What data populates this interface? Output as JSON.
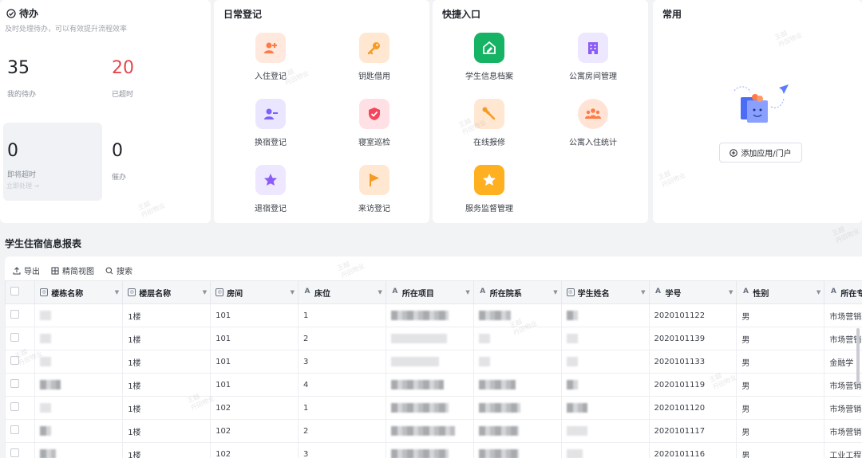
{
  "todo": {
    "title": "待办",
    "subtitle": "及时处理待办，可以有效提升流程效率",
    "my_todo": {
      "value": "35",
      "label": "我的待办"
    },
    "overdue": {
      "value": "20",
      "label": "已超时"
    },
    "soon": {
      "value": "0",
      "label": "即将超时",
      "link": "立即处理 →"
    },
    "pending": {
      "value": "0",
      "label": "催办"
    }
  },
  "daily": {
    "title": "日常登记",
    "items": [
      {
        "label": "入住登记",
        "icon": "user-add-icon",
        "color": "#ff7a45",
        "bg": "#ffe8dd"
      },
      {
        "label": "钥匙借用",
        "icon": "key-icon",
        "color": "#f59a23",
        "bg": "#ffe7d1"
      },
      {
        "label": "换宿登记",
        "icon": "user-switch-icon",
        "color": "#7b61ff",
        "bg": "#ebe6ff"
      },
      {
        "label": "寝室巡检",
        "icon": "shield-check-icon",
        "color": "#f5455c",
        "bg": "#ffe1e5"
      },
      {
        "label": "退宿登记",
        "icon": "star-icon",
        "color": "#8b5cf6",
        "bg": "#ede7ff"
      },
      {
        "label": "来访登记",
        "icon": "flag-icon",
        "color": "#f59a23",
        "bg": "#ffe7d1"
      }
    ]
  },
  "quick": {
    "title": "快捷入口",
    "items": [
      {
        "label": "学生信息档案",
        "icon": "profile-icon",
        "color": "#ffffff",
        "bg": "#16b364"
      },
      {
        "label": "公寓房间管理",
        "icon": "building-icon",
        "color": "#8b5cf6",
        "bg": "#ede7ff"
      },
      {
        "label": "在线报修",
        "icon": "wrench-icon",
        "color": "#f59a23",
        "bg": "#ffe7d1"
      },
      {
        "label": "公寓入住统计",
        "icon": "group-icon",
        "color": "#ff7a45",
        "bg": "#ffe4d6"
      },
      {
        "label": "服务监督管理",
        "icon": "star-icon",
        "color": "#ffffff",
        "bg": "#ffb020"
      }
    ]
  },
  "common": {
    "title": "常用",
    "add_label": "添加应用/门户"
  },
  "report": {
    "title": "学生住宿信息报表",
    "toolbar": {
      "export": "导出",
      "simple_view": "精简视图",
      "search": "搜索"
    },
    "columns": [
      "楼栋名称",
      "楼层名称",
      "房间",
      "床位",
      "所在项目",
      "所在院系",
      "学生姓名",
      "学号",
      "性别",
      "所在专"
    ],
    "rows": [
      {
        "floor": "1楼",
        "room": "101",
        "bed": "1",
        "id": "2020101122",
        "gender": "男",
        "major": "市场营销"
      },
      {
        "floor": "1楼",
        "room": "101",
        "bed": "2",
        "id": "2020101139",
        "gender": "男",
        "major": "市场营销"
      },
      {
        "floor": "1楼",
        "room": "101",
        "bed": "3",
        "id": "2020101133",
        "gender": "男",
        "major": "金融学"
      },
      {
        "floor": "1楼",
        "room": "101",
        "bed": "4",
        "id": "2020101119",
        "gender": "男",
        "major": "市场营销"
      },
      {
        "floor": "1楼",
        "room": "102",
        "bed": "1",
        "id": "2020101120",
        "gender": "男",
        "major": "市场营销"
      },
      {
        "floor": "1楼",
        "room": "102",
        "bed": "2",
        "id": "2020101117",
        "gender": "男",
        "major": "市场营销"
      },
      {
        "floor": "1楼",
        "room": "102",
        "bed": "3",
        "id": "2020101116",
        "gender": "男",
        "major": "工业工程"
      }
    ]
  },
  "watermark": {
    "line1": "王越",
    "line2": "丹田物业"
  }
}
